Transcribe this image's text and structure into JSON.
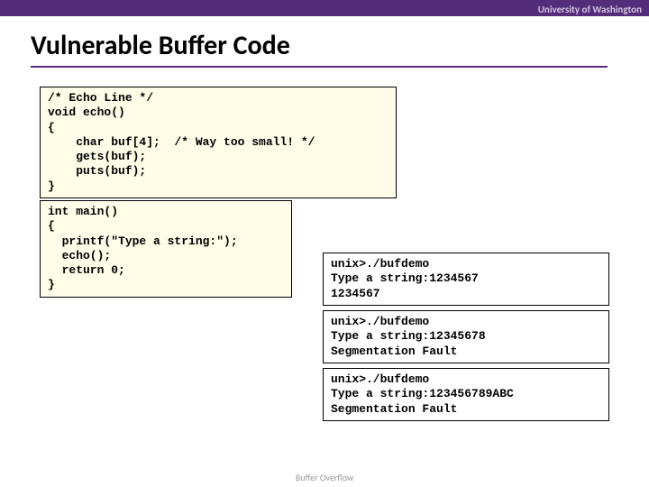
{
  "header": {
    "institution": "University of Washington"
  },
  "title": "Vulnerable Buffer Code",
  "code_echo": "/* Echo Line */\nvoid echo()\n{\n    char buf[4];  /* Way too small! */\n    gets(buf);\n    puts(buf);\n}",
  "code_main": "int main()\n{\n  printf(\"Type a string:\");\n  echo();\n  return 0;\n}",
  "output1": "unix>./bufdemo\nType a string:1234567\n1234567",
  "output2": "unix>./bufdemo\nType a string:12345678\nSegmentation Fault",
  "output3": "unix>./bufdemo\nType a string:123456789ABC\nSegmentation Fault",
  "footer": "Buffer Overflow"
}
